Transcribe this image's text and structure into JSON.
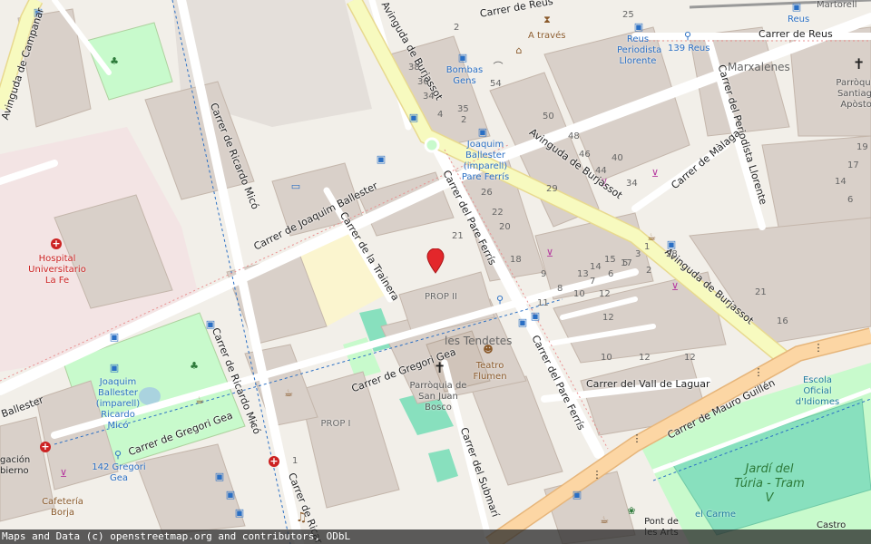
{
  "map": {
    "attribution": "Maps and Data (c) openstreetmap.org and contributors, ODbL",
    "streets": [
      "Carrer de Joaquim Ballester",
      "Carrer de Ricardo Micó",
      "Carrer de Ricardo Micó",
      "Carrer de la Trainera",
      "Carrer del Pare Ferrís",
      "Carrer del Pare Ferrís",
      "Avinguda de Burjassot",
      "Avinguda de Burjassot",
      "Avinguda de Burjassot",
      "Carrer de Gregori Gea",
      "Carrer de Gregori Gea",
      "Carrer del Periodista Llorente",
      "Carrer de Màlaga",
      "Carrer de Reus",
      "Carrer de Reus",
      "Carrer del Vall de Laguar",
      "Carrer de Mauro Guillén",
      "Carrer del Submarí",
      "Ballester",
      "Avinguda de Campanar",
      "Carrer de Ricar"
    ],
    "places": {
      "hospital": "Hospital Universitario La Fe",
      "marxalenes": "Marxalenes",
      "tendetes": "les Tendetes",
      "teatro": "Teatro Flumen",
      "parroquia_bosco": "Parròquia de San Juan Bosco",
      "parroquia_santiago": "Parròquia Santiago Apòstol",
      "prop2": "PROP II",
      "prop1": "PROP I",
      "a_traves": "A través",
      "cafeteria": "Cafetería Borja",
      "escola": "Escola Oficial d'Idiomes",
      "jardi": "Jardí del Túria - Tram V",
      "pont": "Pont de les Arts",
      "carme": "el Carme",
      "castro": "Castro",
      "gacion": "gación",
      "bierno": "bierno",
      "martorell": "Martorell"
    },
    "bus_stops": [
      "Bombas Gens",
      "Joaquim Ballester (imparell) Pare Ferrís",
      "Reus Periodista Llorente",
      "139 Reus",
      "Reus",
      "Joaquim Ballester (imparell) Ricardo Micó",
      "142 Gregori Gea"
    ],
    "house_numbers": [
      "38",
      "36",
      "34",
      "4",
      "35",
      "2",
      "54",
      "50",
      "48",
      "46",
      "44",
      "40",
      "34",
      "29",
      "26",
      "22",
      "20",
      "18",
      "21",
      "25",
      "28",
      "17",
      "15",
      "14",
      "13",
      "12",
      "11",
      "10",
      "9",
      "8",
      "7",
      "6",
      "5",
      "3",
      "1",
      "2",
      "21",
      "19",
      "17",
      "16",
      "12",
      "12",
      "12",
      "10",
      "14",
      "6",
      "1",
      "5",
      "2"
    ],
    "colors": {
      "background": "#f2efe9",
      "building": "#d9d0c9",
      "building_edge": "#c4b6ab",
      "park": "#c8facc",
      "park_dark": "#add19e",
      "water": "#aad3df",
      "primary_road": "#fcd6a4",
      "secondary_road": "#f7fabf",
      "road": "#ffffff",
      "pitch": "#88e0be",
      "hospital_area": "#f0d8d8",
      "school_area": "#ffffe5",
      "marker": "#e3272b",
      "attribution_bg": "#333333"
    },
    "icons": [
      "marker-pin-icon",
      "bus-stop-icon",
      "hospital-icon",
      "church-icon",
      "theatre-icon",
      "bank-icon",
      "shop-icon",
      "cafe-icon",
      "playground-icon",
      "bicycle-icon",
      "music-icon",
      "parking-icon"
    ]
  }
}
